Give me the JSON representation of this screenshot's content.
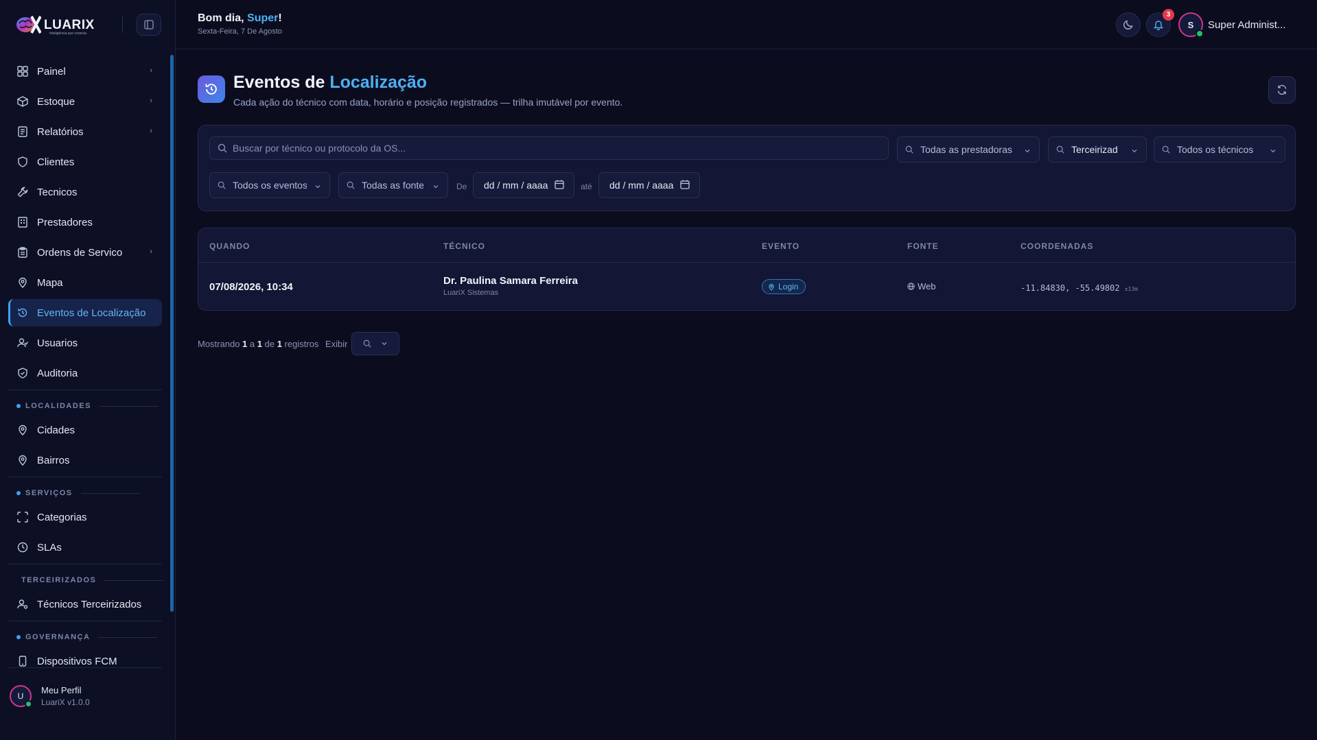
{
  "brand": {
    "name": "LUARIX",
    "tagline": "Inteligência que conecta",
    "colors": {
      "accent": "#4fb0f5",
      "magenta": "#d3358a",
      "online": "#21c16b",
      "badge": "#e5394b"
    }
  },
  "sidebar": {
    "items": [
      {
        "label": "Painel",
        "icon": "dashboard-icon",
        "chevron": true
      },
      {
        "label": "Estoque",
        "icon": "box-icon",
        "chevron": true
      },
      {
        "label": "Relatórios",
        "icon": "report-icon",
        "chevron": true
      },
      {
        "label": "Clientes",
        "icon": "shield-icon",
        "chevron": false
      },
      {
        "label": "Tecnicos",
        "icon": "wrench-icon",
        "chevron": false
      },
      {
        "label": "Prestadores",
        "icon": "building-icon",
        "chevron": false
      },
      {
        "label": "Ordens de Servico",
        "icon": "clipboard-icon",
        "chevron": true
      },
      {
        "label": "Mapa",
        "icon": "map-pin-icon",
        "chevron": false
      },
      {
        "label": "Eventos de Localização",
        "icon": "history-icon",
        "chevron": false,
        "active": true
      },
      {
        "label": "Usuarios",
        "icon": "user-icon",
        "chevron": false
      },
      {
        "label": "Auditoria",
        "icon": "shield-check-icon",
        "chevron": false
      }
    ],
    "sections": {
      "localidades": {
        "label": "LOCALIDADES",
        "items": [
          "Cidades",
          "Bairros"
        ]
      },
      "servicos": {
        "label": "SERVIÇOS",
        "items": [
          "Categorias",
          "SLAs"
        ]
      },
      "terceirizados": {
        "label": "TERCEIRIZADOS",
        "items": [
          "Técnicos Terceirizados"
        ]
      },
      "governanca": {
        "label": "GOVERNANÇA",
        "items": [
          "Dispositivos FCM"
        ]
      }
    },
    "profile": {
      "initial": "U",
      "name": "Meu Perfil",
      "version": "LuariX v1.0.0"
    }
  },
  "header": {
    "greeting_prefix": "Bom dia, ",
    "greeting_name": "Super",
    "greeting_suffix": "!",
    "date": "Sexta-Feira, 7 De Agosto",
    "notifications_count": "3",
    "user_initial": "S",
    "user_name": "Super Administ..."
  },
  "page": {
    "title_prefix": "Eventos de ",
    "title_highlight": "Localização",
    "subtitle": "Cada ação do técnico com data, horário e posição registrados — trilha imutável por evento."
  },
  "filters": {
    "search_placeholder": "Buscar por técnico ou protocolo da OS...",
    "prestadoras": "Todas as prestadoras",
    "tipo": "Terceirizad",
    "tecnicos": "Todos os técnicos",
    "eventos": "Todos os eventos",
    "fontes": "Todas as fontes",
    "de_label": "De",
    "ate_label": "até",
    "date_placeholder_from": "dd / mm / aaaa",
    "date_placeholder_to": "dd / mm / aaaa"
  },
  "table": {
    "columns": [
      "QUANDO",
      "TÉCNICO",
      "EVENTO",
      "FONTE",
      "COORDENADAS"
    ],
    "rows": [
      {
        "when": "07/08/2026, 10:34",
        "tech_name": "Dr. Paulina Samara Ferreira",
        "tech_org": "LuariX Sistemas",
        "event": "Login",
        "source": "Web",
        "coords": "-11.84830, -55.49802",
        "accuracy": "±13m"
      }
    ]
  },
  "pager": {
    "showing": "Mostrando",
    "from": "1",
    "a": "a",
    "to": "1",
    "de": "de",
    "total": "1",
    "registros": "registros",
    "exibir": "Exibir"
  }
}
